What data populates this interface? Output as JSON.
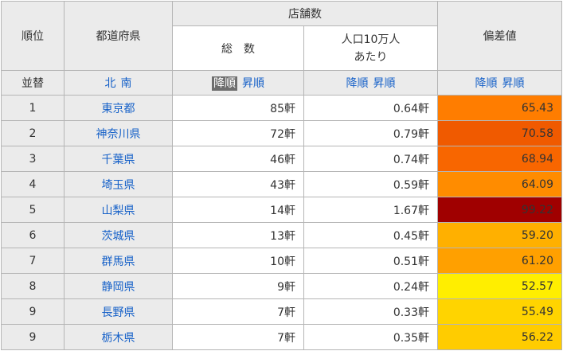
{
  "header": {
    "rank": "順位",
    "prefecture": "都道府県",
    "stores": "店舗数",
    "total": "総　数",
    "per100k_line1": "人口10万人",
    "per100k_line2": "あたり",
    "deviation": "偏差値"
  },
  "sort": {
    "reorder": "並替",
    "north": "北",
    "south": "南",
    "desc": "降順",
    "asc": "昇順"
  },
  "rows": [
    {
      "rank": "1",
      "pref": "東京都",
      "total": "85軒",
      "per": "0.64軒",
      "dev": "65.43",
      "color": "#ff7d00"
    },
    {
      "rank": "2",
      "pref": "神奈川県",
      "total": "72軒",
      "per": "0.79軒",
      "dev": "70.58",
      "color": "#f05a00"
    },
    {
      "rank": "3",
      "pref": "千葉県",
      "total": "46軒",
      "per": "0.74軒",
      "dev": "68.94",
      "color": "#f86600"
    },
    {
      "rank": "4",
      "pref": "埼玉県",
      "total": "43軒",
      "per": "0.59軒",
      "dev": "64.09",
      "color": "#ff8c00"
    },
    {
      "rank": "5",
      "pref": "山梨県",
      "total": "14軒",
      "per": "1.67軒",
      "dev": "99.22",
      "color": "#a00000"
    },
    {
      "rank": "6",
      "pref": "茨城県",
      "total": "13軒",
      "per": "0.45軒",
      "dev": "59.20",
      "color": "#ffb000"
    },
    {
      "rank": "7",
      "pref": "群馬県",
      "total": "10軒",
      "per": "0.51軒",
      "dev": "61.20",
      "color": "#ffa000"
    },
    {
      "rank": "8",
      "pref": "静岡県",
      "total": "9軒",
      "per": "0.24軒",
      "dev": "52.57",
      "color": "#ffee00"
    },
    {
      "rank": "9",
      "pref": "長野県",
      "total": "7軒",
      "per": "0.33軒",
      "dev": "55.49",
      "color": "#ffd400"
    },
    {
      "rank": "9",
      "pref": "栃木県",
      "total": "7軒",
      "per": "0.35軒",
      "dev": "56.22",
      "color": "#ffcc00"
    }
  ]
}
